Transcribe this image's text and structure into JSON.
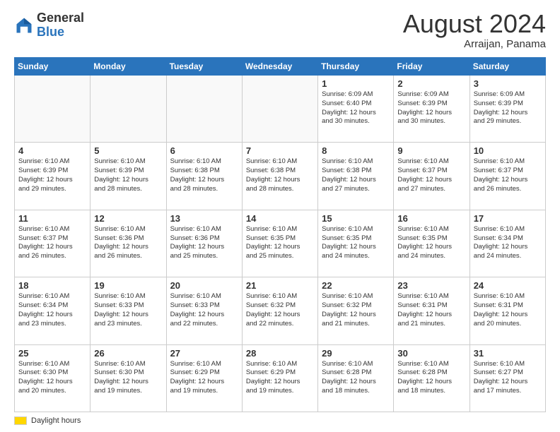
{
  "header": {
    "logo": {
      "general": "General",
      "blue": "Blue"
    },
    "month_year": "August 2024",
    "location": "Arraijan, Panama"
  },
  "days_of_week": [
    "Sunday",
    "Monday",
    "Tuesday",
    "Wednesday",
    "Thursday",
    "Friday",
    "Saturday"
  ],
  "weeks": [
    [
      {
        "day": "",
        "info": ""
      },
      {
        "day": "",
        "info": ""
      },
      {
        "day": "",
        "info": ""
      },
      {
        "day": "",
        "info": ""
      },
      {
        "day": "1",
        "info": "Sunrise: 6:09 AM\nSunset: 6:40 PM\nDaylight: 12 hours\nand 30 minutes."
      },
      {
        "day": "2",
        "info": "Sunrise: 6:09 AM\nSunset: 6:39 PM\nDaylight: 12 hours\nand 30 minutes."
      },
      {
        "day": "3",
        "info": "Sunrise: 6:09 AM\nSunset: 6:39 PM\nDaylight: 12 hours\nand 29 minutes."
      }
    ],
    [
      {
        "day": "4",
        "info": "Sunrise: 6:10 AM\nSunset: 6:39 PM\nDaylight: 12 hours\nand 29 minutes."
      },
      {
        "day": "5",
        "info": "Sunrise: 6:10 AM\nSunset: 6:39 PM\nDaylight: 12 hours\nand 28 minutes."
      },
      {
        "day": "6",
        "info": "Sunrise: 6:10 AM\nSunset: 6:38 PM\nDaylight: 12 hours\nand 28 minutes."
      },
      {
        "day": "7",
        "info": "Sunrise: 6:10 AM\nSunset: 6:38 PM\nDaylight: 12 hours\nand 28 minutes."
      },
      {
        "day": "8",
        "info": "Sunrise: 6:10 AM\nSunset: 6:38 PM\nDaylight: 12 hours\nand 27 minutes."
      },
      {
        "day": "9",
        "info": "Sunrise: 6:10 AM\nSunset: 6:37 PM\nDaylight: 12 hours\nand 27 minutes."
      },
      {
        "day": "10",
        "info": "Sunrise: 6:10 AM\nSunset: 6:37 PM\nDaylight: 12 hours\nand 26 minutes."
      }
    ],
    [
      {
        "day": "11",
        "info": "Sunrise: 6:10 AM\nSunset: 6:37 PM\nDaylight: 12 hours\nand 26 minutes."
      },
      {
        "day": "12",
        "info": "Sunrise: 6:10 AM\nSunset: 6:36 PM\nDaylight: 12 hours\nand 26 minutes."
      },
      {
        "day": "13",
        "info": "Sunrise: 6:10 AM\nSunset: 6:36 PM\nDaylight: 12 hours\nand 25 minutes."
      },
      {
        "day": "14",
        "info": "Sunrise: 6:10 AM\nSunset: 6:35 PM\nDaylight: 12 hours\nand 25 minutes."
      },
      {
        "day": "15",
        "info": "Sunrise: 6:10 AM\nSunset: 6:35 PM\nDaylight: 12 hours\nand 24 minutes."
      },
      {
        "day": "16",
        "info": "Sunrise: 6:10 AM\nSunset: 6:35 PM\nDaylight: 12 hours\nand 24 minutes."
      },
      {
        "day": "17",
        "info": "Sunrise: 6:10 AM\nSunset: 6:34 PM\nDaylight: 12 hours\nand 24 minutes."
      }
    ],
    [
      {
        "day": "18",
        "info": "Sunrise: 6:10 AM\nSunset: 6:34 PM\nDaylight: 12 hours\nand 23 minutes."
      },
      {
        "day": "19",
        "info": "Sunrise: 6:10 AM\nSunset: 6:33 PM\nDaylight: 12 hours\nand 23 minutes."
      },
      {
        "day": "20",
        "info": "Sunrise: 6:10 AM\nSunset: 6:33 PM\nDaylight: 12 hours\nand 22 minutes."
      },
      {
        "day": "21",
        "info": "Sunrise: 6:10 AM\nSunset: 6:32 PM\nDaylight: 12 hours\nand 22 minutes."
      },
      {
        "day": "22",
        "info": "Sunrise: 6:10 AM\nSunset: 6:32 PM\nDaylight: 12 hours\nand 21 minutes."
      },
      {
        "day": "23",
        "info": "Sunrise: 6:10 AM\nSunset: 6:31 PM\nDaylight: 12 hours\nand 21 minutes."
      },
      {
        "day": "24",
        "info": "Sunrise: 6:10 AM\nSunset: 6:31 PM\nDaylight: 12 hours\nand 20 minutes."
      }
    ],
    [
      {
        "day": "25",
        "info": "Sunrise: 6:10 AM\nSunset: 6:30 PM\nDaylight: 12 hours\nand 20 minutes."
      },
      {
        "day": "26",
        "info": "Sunrise: 6:10 AM\nSunset: 6:30 PM\nDaylight: 12 hours\nand 19 minutes."
      },
      {
        "day": "27",
        "info": "Sunrise: 6:10 AM\nSunset: 6:29 PM\nDaylight: 12 hours\nand 19 minutes."
      },
      {
        "day": "28",
        "info": "Sunrise: 6:10 AM\nSunset: 6:29 PM\nDaylight: 12 hours\nand 19 minutes."
      },
      {
        "day": "29",
        "info": "Sunrise: 6:10 AM\nSunset: 6:28 PM\nDaylight: 12 hours\nand 18 minutes."
      },
      {
        "day": "30",
        "info": "Sunrise: 6:10 AM\nSunset: 6:28 PM\nDaylight: 12 hours\nand 18 minutes."
      },
      {
        "day": "31",
        "info": "Sunrise: 6:10 AM\nSunset: 6:27 PM\nDaylight: 12 hours\nand 17 minutes."
      }
    ]
  ],
  "footer": {
    "label": "Daylight hours"
  }
}
